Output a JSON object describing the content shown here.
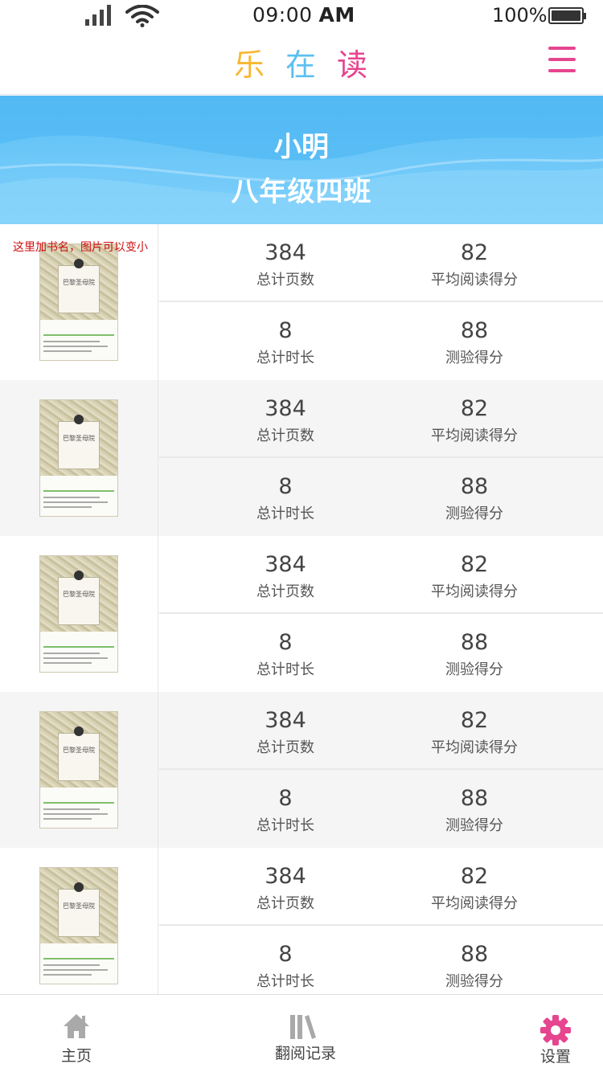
{
  "status_bar": {
    "time": "09:00",
    "ampm": "AM",
    "battery": "100%"
  },
  "header": {
    "logo_chars": [
      "乐",
      "在",
      "读"
    ],
    "logo_colors": [
      "#f7b733",
      "#5bc0f0",
      "#e6458f"
    ],
    "menu_icon": "hamburger-menu-icon",
    "menu_color": "#e6458f"
  },
  "banner": {
    "name": "小明",
    "class_name": "八年级四班"
  },
  "books": [
    {
      "note": "这里加书名，图片可以变小",
      "cover_title": "巴黎圣母院",
      "pages_value": "384",
      "pages_label": "总计页数",
      "avg_value": "82",
      "avg_label": "平均阅读得分",
      "time_value": "8",
      "time_label": "总计时长",
      "quiz_value": "88",
      "quiz_label": "测验得分"
    },
    {
      "cover_title": "巴黎圣母院",
      "pages_value": "384",
      "pages_label": "总计页数",
      "avg_value": "82",
      "avg_label": "平均阅读得分",
      "time_value": "8",
      "time_label": "总计时长",
      "quiz_value": "88",
      "quiz_label": "测验得分"
    },
    {
      "cover_title": "巴黎圣母院",
      "pages_value": "384",
      "pages_label": "总计页数",
      "avg_value": "82",
      "avg_label": "平均阅读得分",
      "time_value": "8",
      "time_label": "总计时长",
      "quiz_value": "88",
      "quiz_label": "测验得分"
    },
    {
      "cover_title": "巴黎圣母院",
      "pages_value": "384",
      "pages_label": "总计页数",
      "avg_value": "82",
      "avg_label": "平均阅读得分",
      "time_value": "8",
      "time_label": "总计时长",
      "quiz_value": "88",
      "quiz_label": "测验得分"
    },
    {
      "cover_title": "巴黎圣母院",
      "pages_value": "384",
      "pages_label": "总计页数",
      "avg_value": "82",
      "avg_label": "平均阅读得分",
      "time_value": "8",
      "time_label": "总计时长",
      "quiz_value": "88",
      "quiz_label": "测验得分"
    }
  ],
  "tab_bar": {
    "tabs": [
      {
        "label": "主页",
        "icon": "home-icon",
        "active": false
      },
      {
        "label": "翻阅记录",
        "icon": "books-icon",
        "active": false
      },
      {
        "label": "设置",
        "icon": "gear-icon",
        "active": true
      }
    ],
    "inactive_icon_color": "#a9a9a9",
    "active_icon_color": "#e6458f"
  }
}
